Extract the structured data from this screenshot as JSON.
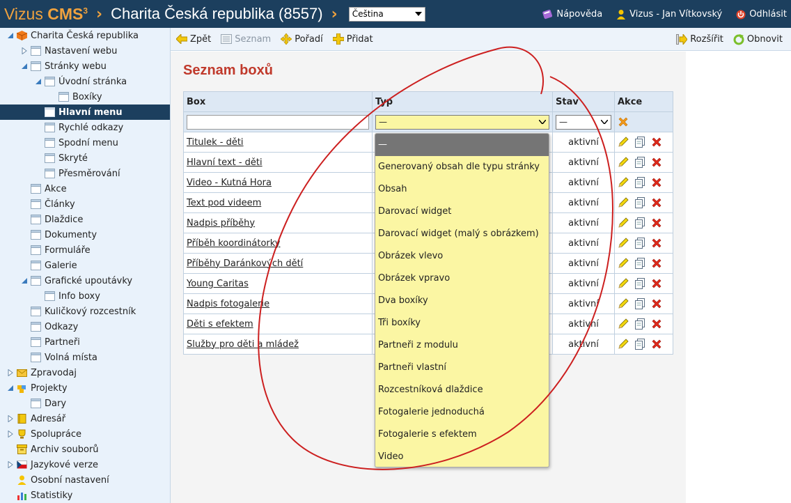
{
  "header": {
    "logo_main": "Vizus",
    "logo_cms": "CMS",
    "logo_sup": "3",
    "site_title": "Charita Česká republika (8557)",
    "language": "Čeština",
    "help": "Nápověda",
    "user": "Vizus - Jan Vítkovský",
    "logout": "Odhlásit"
  },
  "sidebar": {
    "root": "Charita Česká republika",
    "items": [
      {
        "label": "Nastavení webu"
      },
      {
        "label": "Stránky webu"
      },
      {
        "label": "Úvodní stránka"
      },
      {
        "label": "Boxíky"
      },
      {
        "label": "Hlavní menu"
      },
      {
        "label": "Rychlé odkazy"
      },
      {
        "label": "Spodní menu"
      },
      {
        "label": "Skryté"
      },
      {
        "label": "Přesměrování"
      },
      {
        "label": "Akce"
      },
      {
        "label": "Články"
      },
      {
        "label": "Dlaždice"
      },
      {
        "label": "Dokumenty"
      },
      {
        "label": "Formuláře"
      },
      {
        "label": "Galerie"
      },
      {
        "label": "Grafické upoutávky"
      },
      {
        "label": "Info boxy"
      },
      {
        "label": "Kuličkový rozcestník"
      },
      {
        "label": "Odkazy"
      },
      {
        "label": "Partneři"
      },
      {
        "label": "Volná místa"
      },
      {
        "label": "Zpravodaj"
      },
      {
        "label": "Projekty"
      },
      {
        "label": "Dary"
      },
      {
        "label": "Adresář"
      },
      {
        "label": "Spolupráce"
      },
      {
        "label": "Archiv souborů"
      },
      {
        "label": "Jazykové verze"
      },
      {
        "label": "Osobní nastavení"
      },
      {
        "label": "Statistiky"
      }
    ]
  },
  "toolbar": {
    "back": "Zpět",
    "list": "Seznam",
    "order": "Pořadí",
    "add": "Přidat",
    "expand": "Rozšířit",
    "refresh": "Obnovit"
  },
  "main": {
    "title": "Seznam boxů",
    "columns": [
      "Box",
      "Typ",
      "Stav",
      "Akce"
    ],
    "filter": {
      "typ": "—",
      "stav": "—"
    },
    "rows": [
      {
        "box": "Titulek - děti",
        "stav": "aktivní"
      },
      {
        "box": "Hlavní text - děti",
        "stav": "aktivní"
      },
      {
        "box": "Video - Kutná Hora",
        "stav": "aktivní"
      },
      {
        "box": "Text pod videem",
        "stav": "aktivní"
      },
      {
        "box": "Nadpis příběhy",
        "stav": "aktivní"
      },
      {
        "box": "Příběh koordinátorky",
        "stav": "aktivní"
      },
      {
        "box": "Příběhy Daránkových dětí",
        "stav": "aktivní"
      },
      {
        "box": "Young Caritas",
        "stav": "aktivní"
      },
      {
        "box": "Nadpis fotogalerie",
        "stav": "aktivní"
      },
      {
        "box": "Děti s efektem",
        "stav": "aktivní"
      },
      {
        "box": "Služby pro děti a mládež",
        "stav": "aktivní"
      }
    ]
  },
  "dropdown": {
    "options": [
      "—",
      "Generovaný obsah dle typu stránky",
      "Obsah",
      "Darovací widget",
      "Darovací widget (malý s obrázkem)",
      "Obrázek vlevo",
      "Obrázek vpravo",
      "Dva boxíky",
      "Tři boxíky",
      "Partneři z modulu",
      "Partneři vlastní",
      "Rozcestníková dlaždice",
      "Fotogalerie jednoduchá",
      "Fotogalerie s efektem",
      "Video"
    ]
  },
  "colors": {
    "header_bg": "#1c3f5e",
    "accent_orange": "#f0a23e",
    "title_red": "#c0392b",
    "dropdown_bg": "#fbf6a3",
    "annotation_red": "#cc1f1f"
  }
}
